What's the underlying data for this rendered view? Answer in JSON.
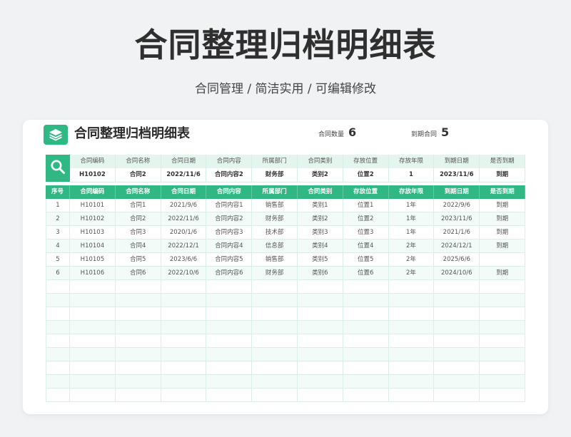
{
  "header": {
    "title": "合同整理归档明细表",
    "subtitle": "合同管理 / 简洁实用 / 可编辑修改"
  },
  "sheet": {
    "title": "合同整理归档明细表",
    "stats": {
      "count_label": "合同数量",
      "count_value": "6",
      "expired_label": "到期合同",
      "expired_value": "5"
    }
  },
  "search": {
    "headers": [
      "合同编码",
      "合同名称",
      "合同日期",
      "合同内容",
      "所属部门",
      "合同类别",
      "存放位置",
      "存放年限",
      "到期日期",
      "是否到期"
    ],
    "values": [
      "H10102",
      "合同2",
      "2022/11/6",
      "合同内容2",
      "财务部",
      "类别2",
      "位置2",
      "1",
      "2023/11/6",
      "到期"
    ]
  },
  "table": {
    "columns": [
      "序号",
      "合同编码",
      "合同名称",
      "合同日期",
      "合同内容",
      "所属部门",
      "合同类别",
      "存放位置",
      "存放年限",
      "到期日期",
      "是否到期"
    ],
    "rows": [
      [
        "1",
        "H10101",
        "合同1",
        "2021/9/6",
        "合同内容1",
        "销售部",
        "类别1",
        "位置1",
        "1年",
        "2022/9/6",
        "到期"
      ],
      [
        "2",
        "H10102",
        "合同2",
        "2022/11/6",
        "合同内容2",
        "财务部",
        "类别2",
        "位置2",
        "1年",
        "2023/11/6",
        "到期"
      ],
      [
        "3",
        "H10103",
        "合同3",
        "2020/1/6",
        "合同内容3",
        "技术部",
        "类别3",
        "位置3",
        "1年",
        "2021/1/6",
        "到期"
      ],
      [
        "4",
        "H10104",
        "合同4",
        "2022/12/1",
        "合同内容4",
        "信息部",
        "类别4",
        "位置4",
        "2年",
        "2024/12/1",
        "到期"
      ],
      [
        "5",
        "H10105",
        "合同5",
        "2023/6/6",
        "合同内容5",
        "销售部",
        "类别5",
        "位置5",
        "2年",
        "2025/6/6",
        ""
      ],
      [
        "6",
        "H10106",
        "合同6",
        "2022/10/6",
        "合同内容6",
        "财务部",
        "类别6",
        "位置6",
        "2年",
        "2024/10/6",
        "到期"
      ]
    ],
    "empty_rows": 9
  },
  "icons": {
    "logo": "layers-icon",
    "search": "search-icon"
  },
  "colors": {
    "accent": "#2fb884",
    "header_tint": "#e4f5ee",
    "row_alt": "#f3fbf8"
  }
}
